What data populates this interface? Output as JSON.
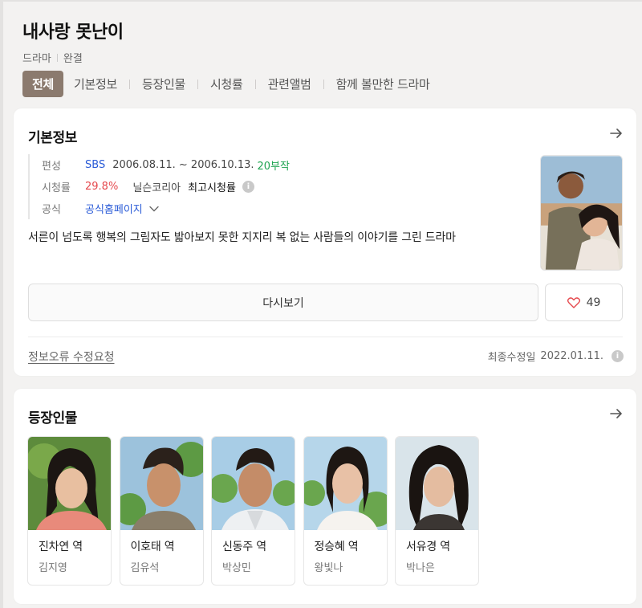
{
  "header": {
    "title": "내사랑 못난이",
    "genre": "드라마",
    "status": "완결"
  },
  "tabs": [
    {
      "label": "전체",
      "active": true
    },
    {
      "label": "기본정보",
      "active": false
    },
    {
      "label": "등장인물",
      "active": false
    },
    {
      "label": "시청률",
      "active": false
    },
    {
      "label": "관련앨범",
      "active": false
    },
    {
      "label": "함께 볼만한 드라마",
      "active": false
    }
  ],
  "basic_info": {
    "section_title": "기본정보",
    "broadcast": {
      "label": "편성",
      "channel": "SBS",
      "period": "2006.08.11. ~ 2006.10.13.",
      "episodes": "20부작"
    },
    "rating": {
      "label": "시청률",
      "value": "29.8%",
      "source": "닐슨코리아",
      "desc": "최고시청률"
    },
    "official": {
      "label": "공식",
      "link": "공식홈페이지"
    },
    "description": "서른이 넘도록 행복의 그림자도 밟아보지 못한 지지리 복 없는 사람들의 이야기를 그린 드라마",
    "replay_label": "다시보기",
    "like_count": "49",
    "report_label": "정보오류 수정요청",
    "modified_label": "최종수정일",
    "modified_date": "2022.01.11."
  },
  "cast_section": {
    "title": "등장인물",
    "members": [
      {
        "role": "진차연 역",
        "actor": "김지영"
      },
      {
        "role": "이호태 역",
        "actor": "김유석"
      },
      {
        "role": "신동주 역",
        "actor": "박상민"
      },
      {
        "role": "정승혜 역",
        "actor": "왕빛나"
      },
      {
        "role": "서유경 역",
        "actor": "박나은"
      }
    ]
  },
  "colors": {
    "accent_tab": "#8b7a6e",
    "link_blue": "#2a5bd7",
    "rating_red": "#e5484d",
    "episodes_green": "#1ea451",
    "background": "#f3f2f1"
  }
}
